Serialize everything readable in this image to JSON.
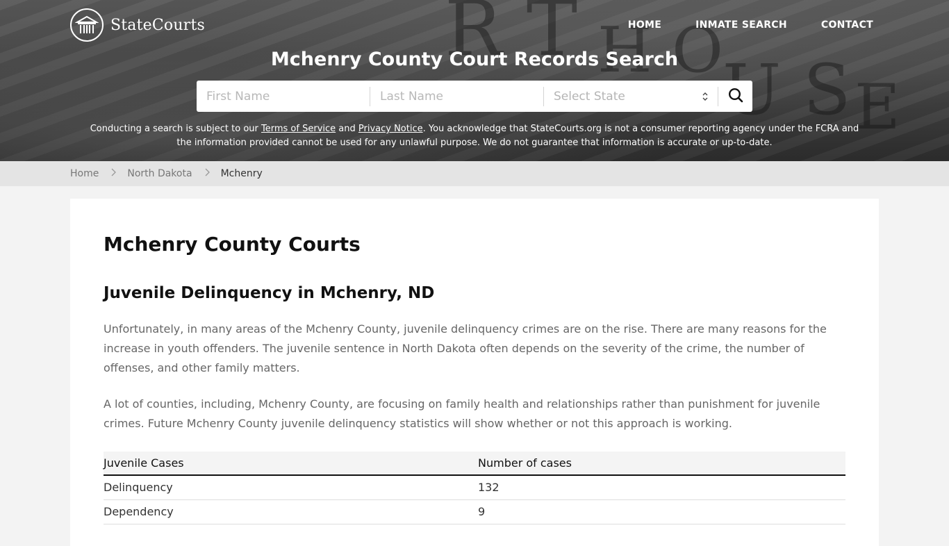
{
  "header": {
    "brand": "StateCourts",
    "nav": [
      {
        "label": "HOME"
      },
      {
        "label": "INMATE SEARCH"
      },
      {
        "label": "CONTACT"
      }
    ],
    "title": "Mchenry County Court Records Search"
  },
  "search": {
    "first_name_placeholder": "First Name",
    "last_name_placeholder": "Last Name",
    "state_select_value": "Select State",
    "search_icon": "search-icon"
  },
  "disclaimer": {
    "part1": "Conducting a search is subject to our ",
    "terms_link": "Terms of Service",
    "part2": " and ",
    "privacy_link": "Privacy Notice",
    "part3": ". You acknowledge that StateCourts.org is not a consumer reporting agency under the FCRA and the information provided cannot be used for any unlawful purpose. We do not guarantee that information is accurate or up-to-date."
  },
  "breadcrumb": [
    {
      "label": "Home"
    },
    {
      "label": "North Dakota"
    },
    {
      "label": "Mchenry"
    }
  ],
  "main": {
    "page_title": "Mchenry County Courts",
    "section_title": "Juvenile Delinquency in Mchenry, ND",
    "paragraphs": [
      "Unfortunately, in many areas of the Mchenry County, juvenile delinquency crimes are on the rise. There are many reasons for the increase in youth offenders. The juvenile sentence in North Dakota often depends on the severity of the crime, the number of offenses, and other family matters.",
      "A lot of counties, including, Mchenry County, are focusing on family health and relationships rather than punishment for juvenile crimes. Future Mchenry County juvenile delinquency statistics will show whether or not this approach is working."
    ],
    "table": {
      "headers": [
        "Juvenile Cases",
        "Number of cases"
      ],
      "rows": [
        [
          "Delinquency",
          "132"
        ],
        [
          "Dependency",
          "9"
        ]
      ]
    }
  },
  "colors": {
    "hero_overlay": "#3a3a3a",
    "breadcrumb_bg": "#e4e4e4",
    "page_bg": "#f3f3f3",
    "body_text": "#666666"
  }
}
